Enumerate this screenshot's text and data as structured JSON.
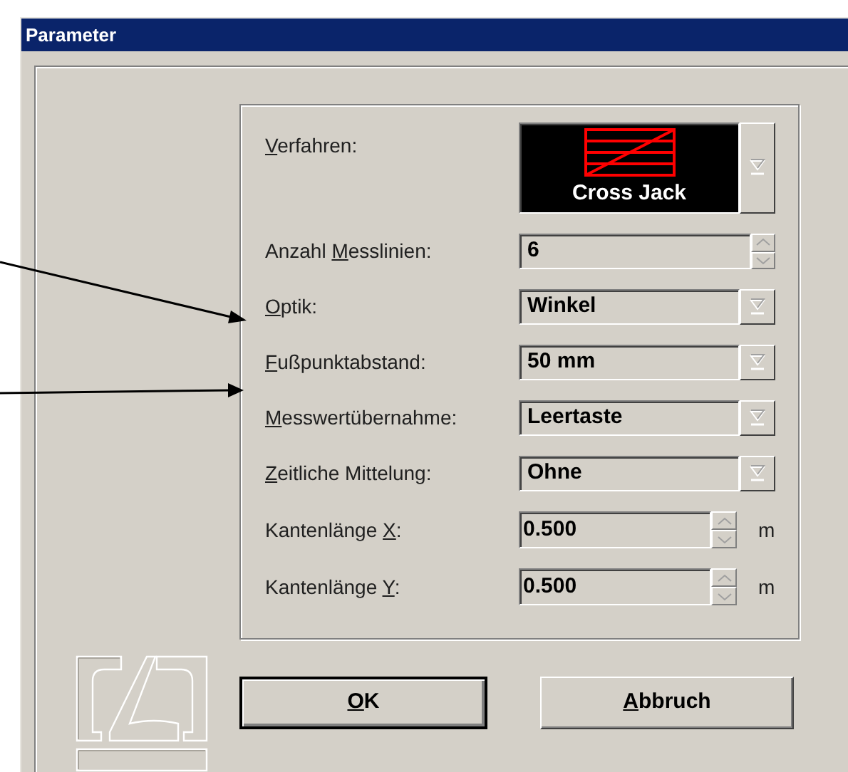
{
  "window": {
    "title": "Parameter"
  },
  "fields": [
    {
      "kind": "image_dropdown",
      "label_key": "V",
      "label_after": "erfahren:",
      "value": "Cross Jack"
    },
    {
      "kind": "spinner",
      "label_before": "Anzahl ",
      "label_key": "M",
      "label_after": "esslinien:",
      "value": "6"
    },
    {
      "kind": "dropdown",
      "label_key": "O",
      "label_after": "ptik:",
      "value": "Winkel"
    },
    {
      "kind": "dropdown",
      "label_key": "F",
      "label_after": "ußpunktabstand:",
      "value": "50 mm"
    },
    {
      "kind": "dropdown",
      "label_key": "M",
      "label_after": "esswertübernahme:",
      "value": "Leertaste"
    },
    {
      "kind": "dropdown",
      "label_key": "Z",
      "label_after": "eitliche Mittelung:",
      "value": "Ohne"
    },
    {
      "kind": "spinner_unit",
      "label_before": "Kantenlänge ",
      "label_key": "X",
      "label_after": ":",
      "value": "0.500",
      "unit": "m"
    },
    {
      "kind": "spinner_unit",
      "label_before": "Kantenlänge ",
      "label_key": "Y",
      "label_after": ":",
      "value": "0.500",
      "unit": "m"
    }
  ],
  "buttons": [
    {
      "label_key": "O",
      "label_after": "K",
      "default": true
    },
    {
      "label_key": "A",
      "label_after": "bbruch",
      "default": false
    }
  ]
}
